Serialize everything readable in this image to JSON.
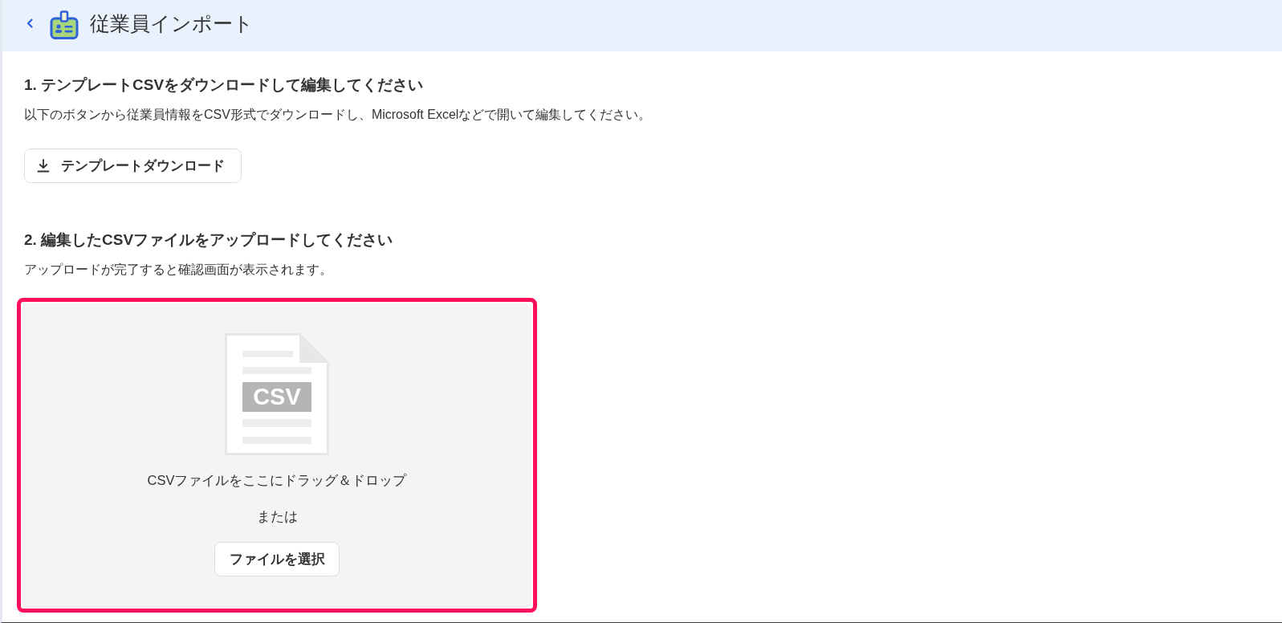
{
  "header": {
    "title": "従業員インポート"
  },
  "steps": [
    {
      "kind": "download",
      "heading": "1. テンプレートCSVをダウンロードして編集してください",
      "description": "以下のボタンから従業員情報をCSV形式でダウンロードし、Microsoft Excelなどで開いて編集してください。",
      "button": "テンプレートダウンロード"
    },
    {
      "kind": "upload",
      "heading": "2. 編集したCSVファイルをアップロードしてください",
      "description": "アップロードが完了すると確認画面が表示されます。",
      "dropzone": {
        "highlighted": true,
        "file_label": "CSV",
        "prompt": "CSVファイルをここにドラッグ＆ドロップ",
        "separator": "または",
        "button": "ファイルを選択"
      }
    }
  ]
}
